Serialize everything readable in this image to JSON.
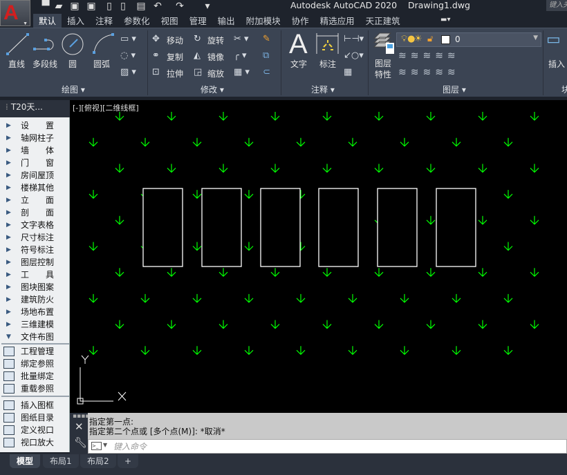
{
  "app": {
    "title": "Autodesk AutoCAD 2020",
    "document": "Drawing1.dwg",
    "search_placeholder": "键入关键字或短语",
    "logo": "A"
  },
  "quick_access": [
    "new-icon",
    "open-icon",
    "save-icon",
    "save-as-icon",
    "open-web-icon",
    "save-web-icon",
    "plot-icon",
    "undo-icon",
    "redo-icon",
    "customize-icon"
  ],
  "tabs": [
    "默认",
    "插入",
    "注释",
    "参数化",
    "视图",
    "管理",
    "输出",
    "附加模块",
    "协作",
    "精选应用",
    "天正建筑"
  ],
  "active_tab": "默认",
  "ribbon": {
    "draw": {
      "label": "绘图",
      "items": [
        "直线",
        "多段线",
        "圆",
        "圆弧"
      ]
    },
    "modify": {
      "label": "修改",
      "items": [
        "移动",
        "旋转",
        "复制",
        "镜像",
        "拉伸",
        "缩放"
      ]
    },
    "annotation": {
      "label": "注释",
      "items": [
        "文字",
        "标注"
      ]
    },
    "layers": {
      "label": "图层",
      "properties": "图层\n特性",
      "current_layer": "0",
      "layer_color": "#ffffff"
    },
    "block": {
      "label": "块",
      "insert": "插入"
    }
  },
  "palette": {
    "title": "T20天...",
    "menu": [
      "设置",
      "轴网柱子",
      "墙体",
      "门窗",
      "房间屋顶",
      "楼梯其他",
      "立面",
      "剖面",
      "文字表格",
      "尺寸标注",
      "符号标注",
      "图层控制",
      "工具",
      "图块图案",
      "建筑防火",
      "场地布置",
      "三维建模",
      "文件布图"
    ],
    "sub1": [
      "工程管理",
      "绑定参照",
      "批量绑定",
      "重载参照"
    ],
    "sub2": [
      "插入图框",
      "图纸目录",
      "定义视口",
      "视口放大"
    ]
  },
  "viewport": {
    "label": "[-][俯视][二维线框]",
    "point_color": "#00ff00",
    "axis_x": "X",
    "axis_y": "Y"
  },
  "command": {
    "history": [
      "指定第一点:",
      "指定第二个点或 [多个点(M)]: *取消*"
    ],
    "placeholder": "键入命令"
  },
  "layout_tabs": [
    "模型",
    "布局1",
    "布局2"
  ],
  "active_layout": "模型",
  "add_layout": "+"
}
